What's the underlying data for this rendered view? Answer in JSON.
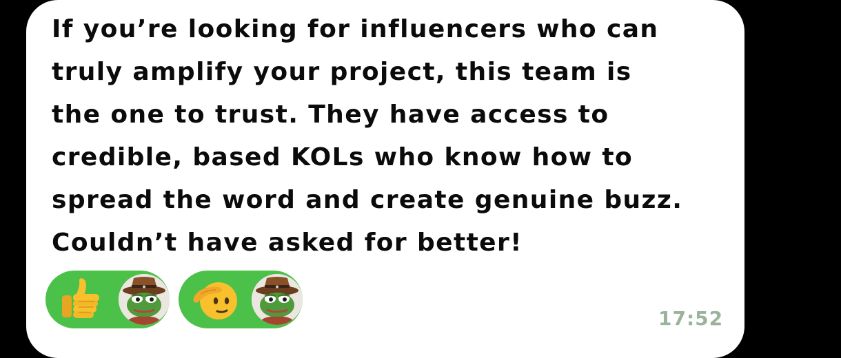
{
  "message": {
    "lines": [
      "If you’re looking for influencers who can",
      "truly amplify your project, this team is",
      "the one to trust. They have access to",
      "credible, based KOLs who know how to",
      "spread the word and create genuine buzz.",
      "Couldn’t have asked for better!"
    ],
    "time": "17:52"
  },
  "reactions": [
    {
      "emoji_icon": "thumbs-up-icon",
      "reactor": "frog-avatar"
    },
    {
      "emoji_icon": "saluting-face-icon",
      "reactor": "frog-avatar"
    }
  ],
  "colors": {
    "background": "#000000",
    "bubble": "#ffffff",
    "text": "#0b0b0b",
    "reaction_pill": "#4cc14a",
    "timestamp": "#9bb39a",
    "emoji_yellow": "#f7c02c"
  }
}
